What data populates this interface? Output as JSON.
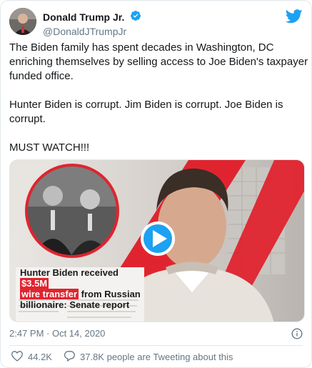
{
  "author": {
    "display_name": "Donald Trump Jr.",
    "handle": "@DonaldJTrumpJr",
    "verified": true,
    "verified_color": "#1da1f2"
  },
  "tweet": {
    "paragraphs": [
      "The Biden family has spent decades in Washington, DC enriching themselves by selling access to Joe Biden's taxpayer funded office.",
      "Hunter Biden is corrupt. Jim Biden is corrupt. Joe Biden is corrupt.",
      "MUST WATCH!!!"
    ]
  },
  "media": {
    "headline_line1": "Hunter Biden received",
    "amount_badge": "$3.5M",
    "headline_line2_highlight": "wire transfer",
    "headline_line2_rest": "from Russian",
    "headline_line3": "billionaire: Senate report",
    "accent_color": "#e0242f",
    "play_button_color": "#1da1f2"
  },
  "meta": {
    "time": "2:47 PM · Oct 14, 2020"
  },
  "actions": {
    "likes": "44.2K",
    "tweeting_about": "37.8K people are Tweeting about this"
  },
  "colors": {
    "brand": "#1da1f2",
    "secondary_text": "#657786",
    "border": "#e1e8ed"
  }
}
